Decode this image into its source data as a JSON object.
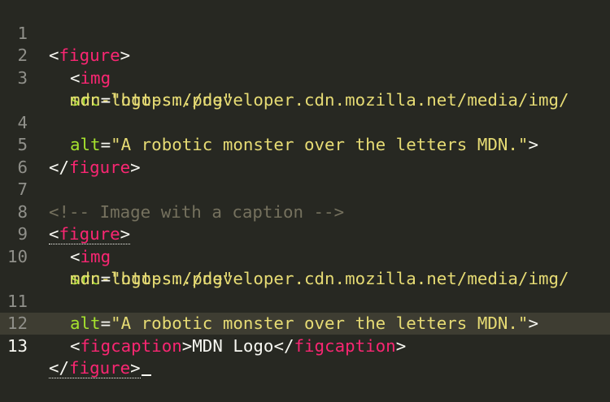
{
  "editor": {
    "theme_colors": {
      "background": "#272822",
      "gutter_text": "#90908a",
      "tag": "#f92672",
      "attribute": "#a6e22e",
      "string": "#e6db74",
      "comment": "#75715e",
      "punctuation": "#f8f8f2"
    },
    "line_numbers": [
      "1",
      "2",
      "3",
      "4",
      "5",
      "6",
      "7",
      "8",
      "9",
      "10",
      "11",
      "12",
      "13"
    ],
    "lines": {
      "l1": {
        "open": "<",
        "tag": "figure",
        "close": ">"
      },
      "l2": {
        "open": "<",
        "tag": "img"
      },
      "l3": {
        "attr": "src",
        "eq": "=",
        "value": "\"https://developer.cdn.mozilla.net/media/img/"
      },
      "l3b": {
        "value": "mdn-logo-sm.png\""
      },
      "l4": {
        "attr": "alt",
        "eq": "=",
        "value": "\"A robotic monster over the letters MDN.\"",
        "close": ">"
      },
      "l5": {
        "open": "</",
        "tag": "figure",
        "close": ">"
      },
      "l7": {
        "comment": "<!-- Image with a caption -->"
      },
      "l8": {
        "open": "<",
        "tag": "figure",
        "close": ">"
      },
      "l9": {
        "open": "<",
        "tag": "img"
      },
      "l10": {
        "attr": "src",
        "eq": "=",
        "value": "\"https://developer.cdn.mozilla.net/media/img/"
      },
      "l10b": {
        "value": "mdn-logo-sm.png\""
      },
      "l11": {
        "attr": "alt",
        "eq": "=",
        "value": "\"A robotic monster over the letters MDN.\"",
        "close": ">"
      },
      "l12": {
        "open": "<",
        "tag": "figcaption",
        "mid": ">",
        "text": "MDN Logo",
        "open2": "</",
        "tag2": "figcaption",
        "close": ">"
      },
      "l13": {
        "open": "</",
        "tag": "figure",
        "close": ">"
      }
    }
  }
}
